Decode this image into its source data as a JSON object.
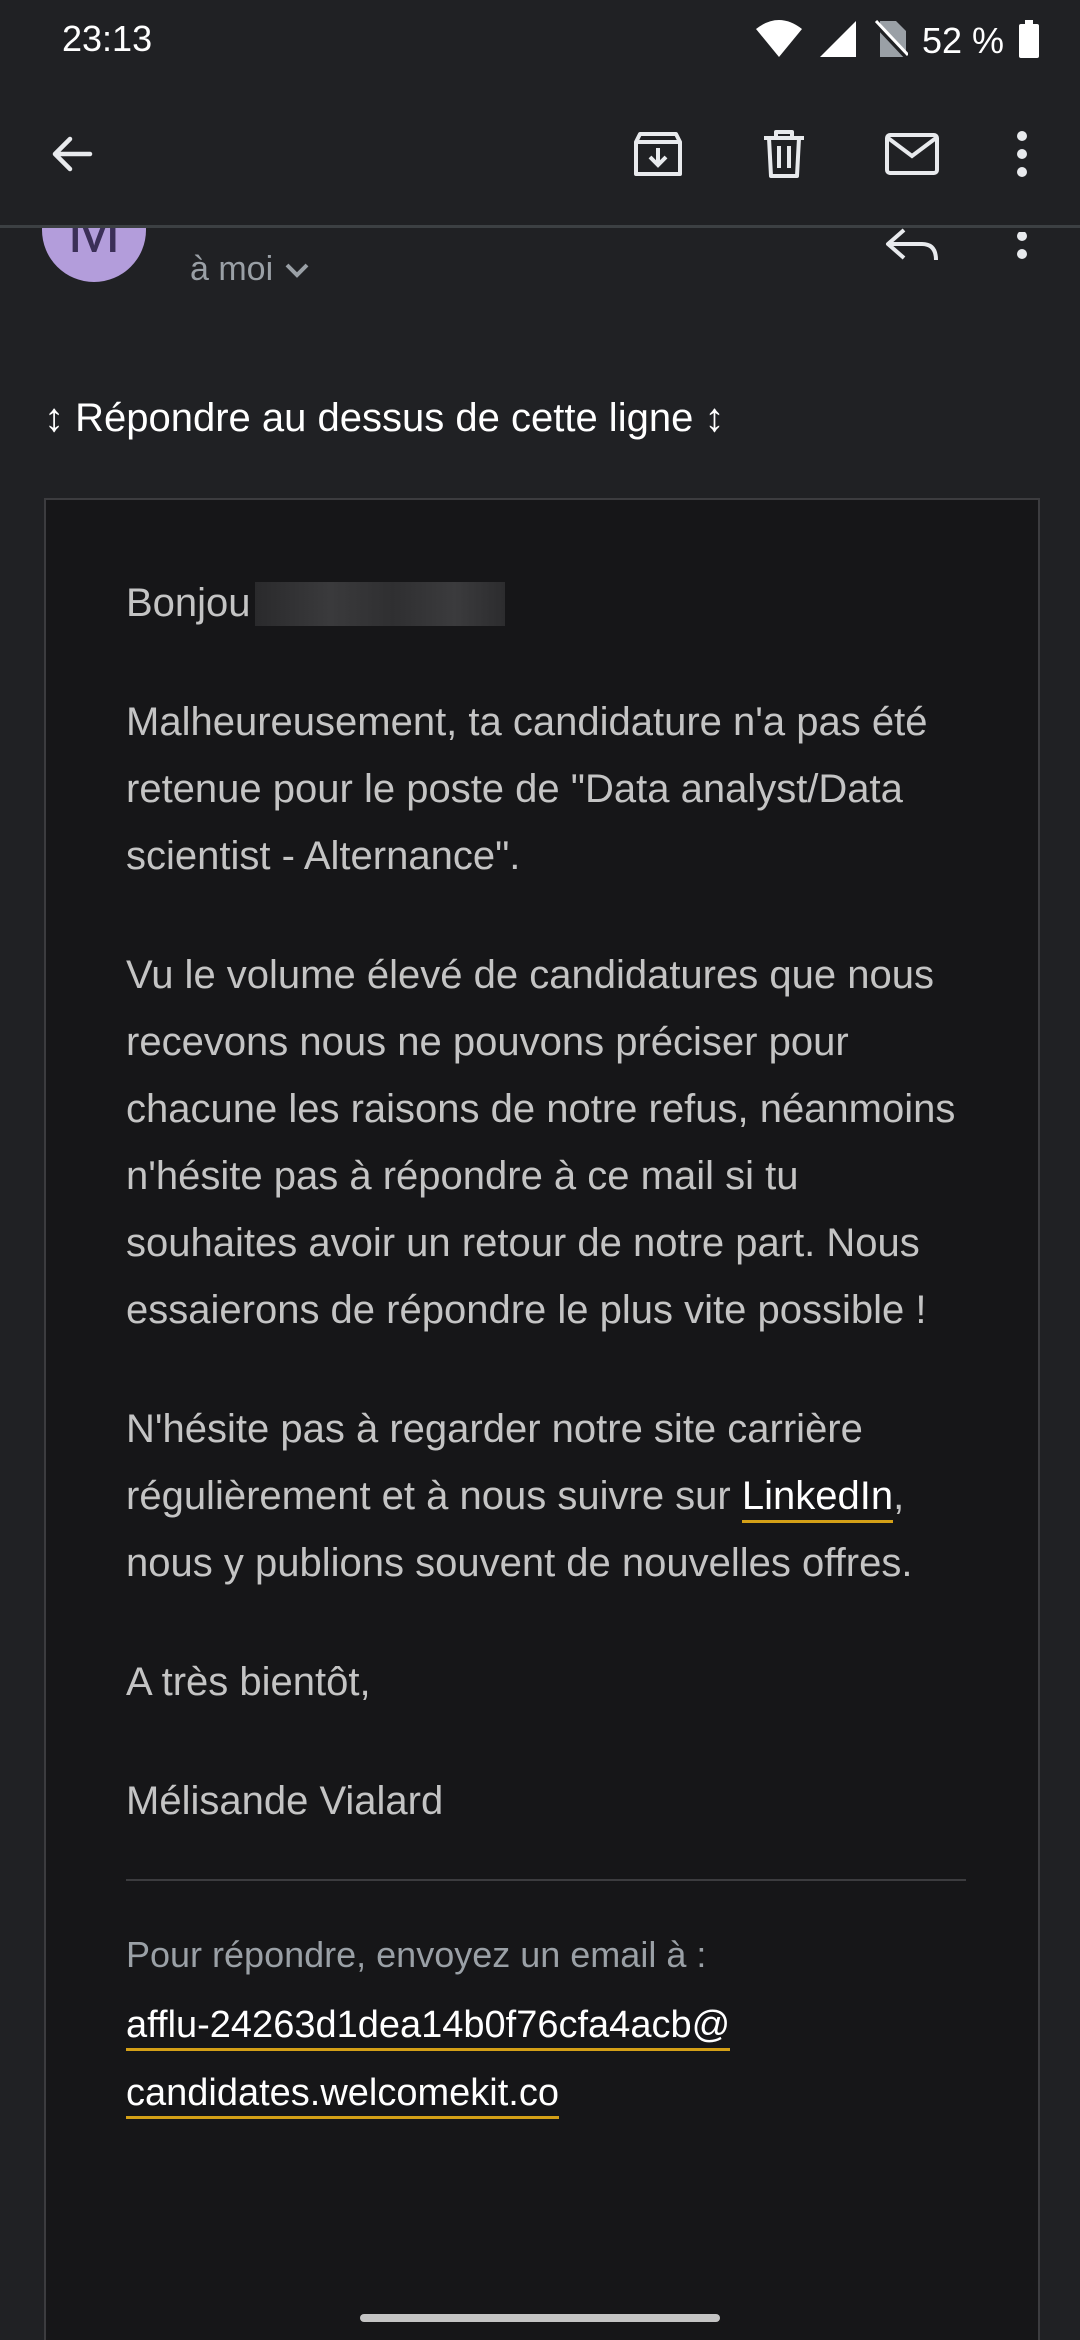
{
  "status_bar": {
    "time": "23:13",
    "battery": "52 %",
    "icons": [
      "wifi-icon",
      "signal-icon",
      "no-sim-icon",
      "battery-icon"
    ]
  },
  "app_bar": {
    "icons": [
      "back-arrow-icon",
      "archive-icon",
      "trash-icon",
      "mail-icon",
      "more-vert-icon"
    ]
  },
  "sender": {
    "avatar_letter": "M",
    "recipient": "à moi"
  },
  "reply_notice": "↕ Répondre au dessus de cette ligne ↕",
  "email": {
    "greeting": "Bonjou",
    "paragraph1": "Malheureusement, ta candidature n'a pas été retenue pour le poste de \"Data analyst/Data scientist - Alternance\".",
    "paragraph2": "Vu le volume élevé de candidatures que nous recevons nous ne pouvons préciser pour chacune les raisons de notre refus, néanmoins n'hésite pas à répondre à ce mail si tu souhaites avoir un retour de notre part. Nous essaierons de répondre le plus vite possible !",
    "paragraph3_before": "N'hésite pas à regarder notre site carrière régulièrement et à nous suivre sur ",
    "linkedin_link": "LinkedIn",
    "paragraph3_after": ", nous y publions souvent de nouvelles offres.",
    "closing": "A très bientôt,",
    "signature": "Mélisande Vialard",
    "reply_hint": "Pour répondre, envoyez un email à :",
    "reply_address_line1": "afflu-24263d1dea14b0f76cfa4acb@",
    "reply_address_line2": "candidates.welcomekit.co"
  },
  "colors": {
    "background": "#202124",
    "card_background": "#161618",
    "avatar": "#b39ddb",
    "link_underline": "#d4a017"
  }
}
